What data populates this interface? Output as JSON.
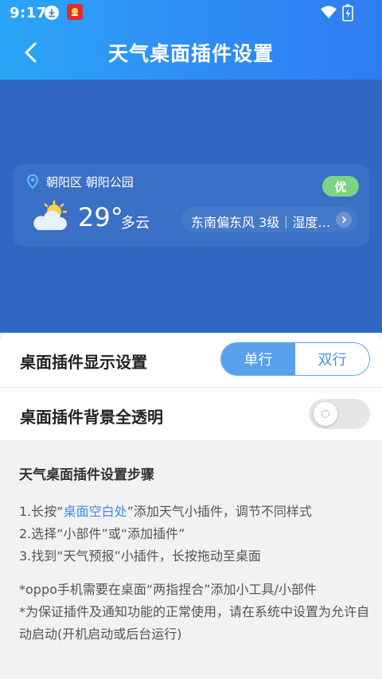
{
  "status_bar": {
    "time": "9:17"
  },
  "header": {
    "title": "天气桌面插件设置"
  },
  "widget_preview": {
    "location": "朝阳区 朝阳公园",
    "aqi": "优",
    "temperature": "29°",
    "condition": "多云",
    "wind_humidity": "东南偏东风 3级｜湿度…"
  },
  "settings": {
    "display_label": "桌面插件显示设置",
    "options": [
      "单行",
      "双行"
    ],
    "selected": "单行",
    "transparent_label": "桌面插件背景全透明",
    "transparent_on": false
  },
  "steps": {
    "title": "天气桌面插件设置步骤",
    "line1_pre": "1.长按“",
    "line1_link": "桌面空白处",
    "line1_post": "”添加天气小插件，调节不同样式",
    "line2": "2.选择“小部件”或“添加插件”",
    "line3": "3.找到“天气预报”小插件，长按拖动至桌面",
    "note1": "*oppo手机需要在桌面“两指捏合”添加小工具/小部件",
    "note2": "*为保证插件及通知功能的正常使用，请在系统中设置为允许自动启动(开机启动或后台运行)"
  },
  "colors": {
    "header_start": "#2aa6f6",
    "header_end": "#2f7cf2",
    "preview_bg": "#2f67c2",
    "accent": "#5aa1ec",
    "aqi_good": "#7bd384"
  }
}
